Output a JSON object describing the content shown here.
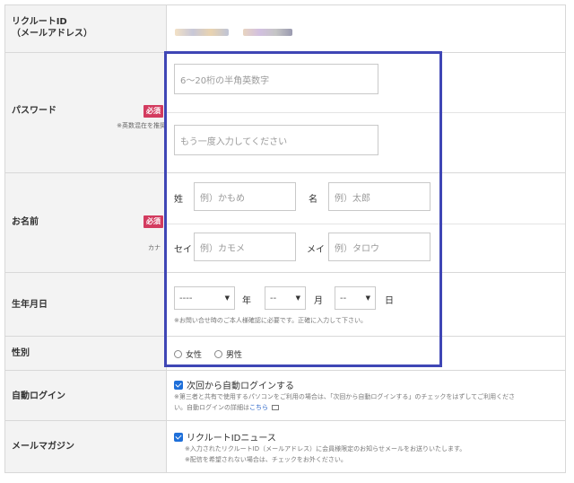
{
  "recruit_id": {
    "label": "リクルートID\n（メールアドレス）"
  },
  "password": {
    "label": "パスワード",
    "required_badge": "必須",
    "note": "※英数混在を推奨",
    "input_placeholder": "6〜20桁の半角英数字",
    "confirm_placeholder": "もう一度入力してください"
  },
  "name": {
    "label": "お名前",
    "required_badge": "必須",
    "kana_label": "カナ",
    "sei_label": "姓",
    "mei_label": "名",
    "sei_placeholder": "例）かもめ",
    "mei_placeholder": "例）太郎",
    "sei_kana_label": "セイ",
    "mei_kana_label": "メイ",
    "sei_kana_placeholder": "例）カモメ",
    "mei_kana_placeholder": "例）タロウ"
  },
  "birthdate": {
    "label": "生年月日",
    "year_value": "----",
    "year_unit": "年",
    "month_value": "--",
    "month_unit": "月",
    "day_value": "--",
    "day_unit": "日",
    "note": "※お問い合せ時のご本人様確認に必要です。正確に入力して下さい。"
  },
  "gender": {
    "label": "性別",
    "options": [
      "女性",
      "男性"
    ]
  },
  "auto_login": {
    "label": "自動ログイン",
    "checkbox_label": "次回から自動ログインする",
    "note_line1": "※第三者と共有で使用するパソコンをご利用の場合は、「次回から自動ログインする」のチェックをはずしてご利用くださ",
    "note_line2": "い。自動ログインの詳細は",
    "note_link": "こちら"
  },
  "mail_magazine": {
    "label": "メールマガジン",
    "checkbox_label": "リクルートIDニュース",
    "note_line1": "※入力されたリクルートID（メールアドレス）に会員様限定のお知らせメールをお送りいたします。",
    "note_line2": "※配信を希望されない場合は、チェックをお外ください。"
  }
}
